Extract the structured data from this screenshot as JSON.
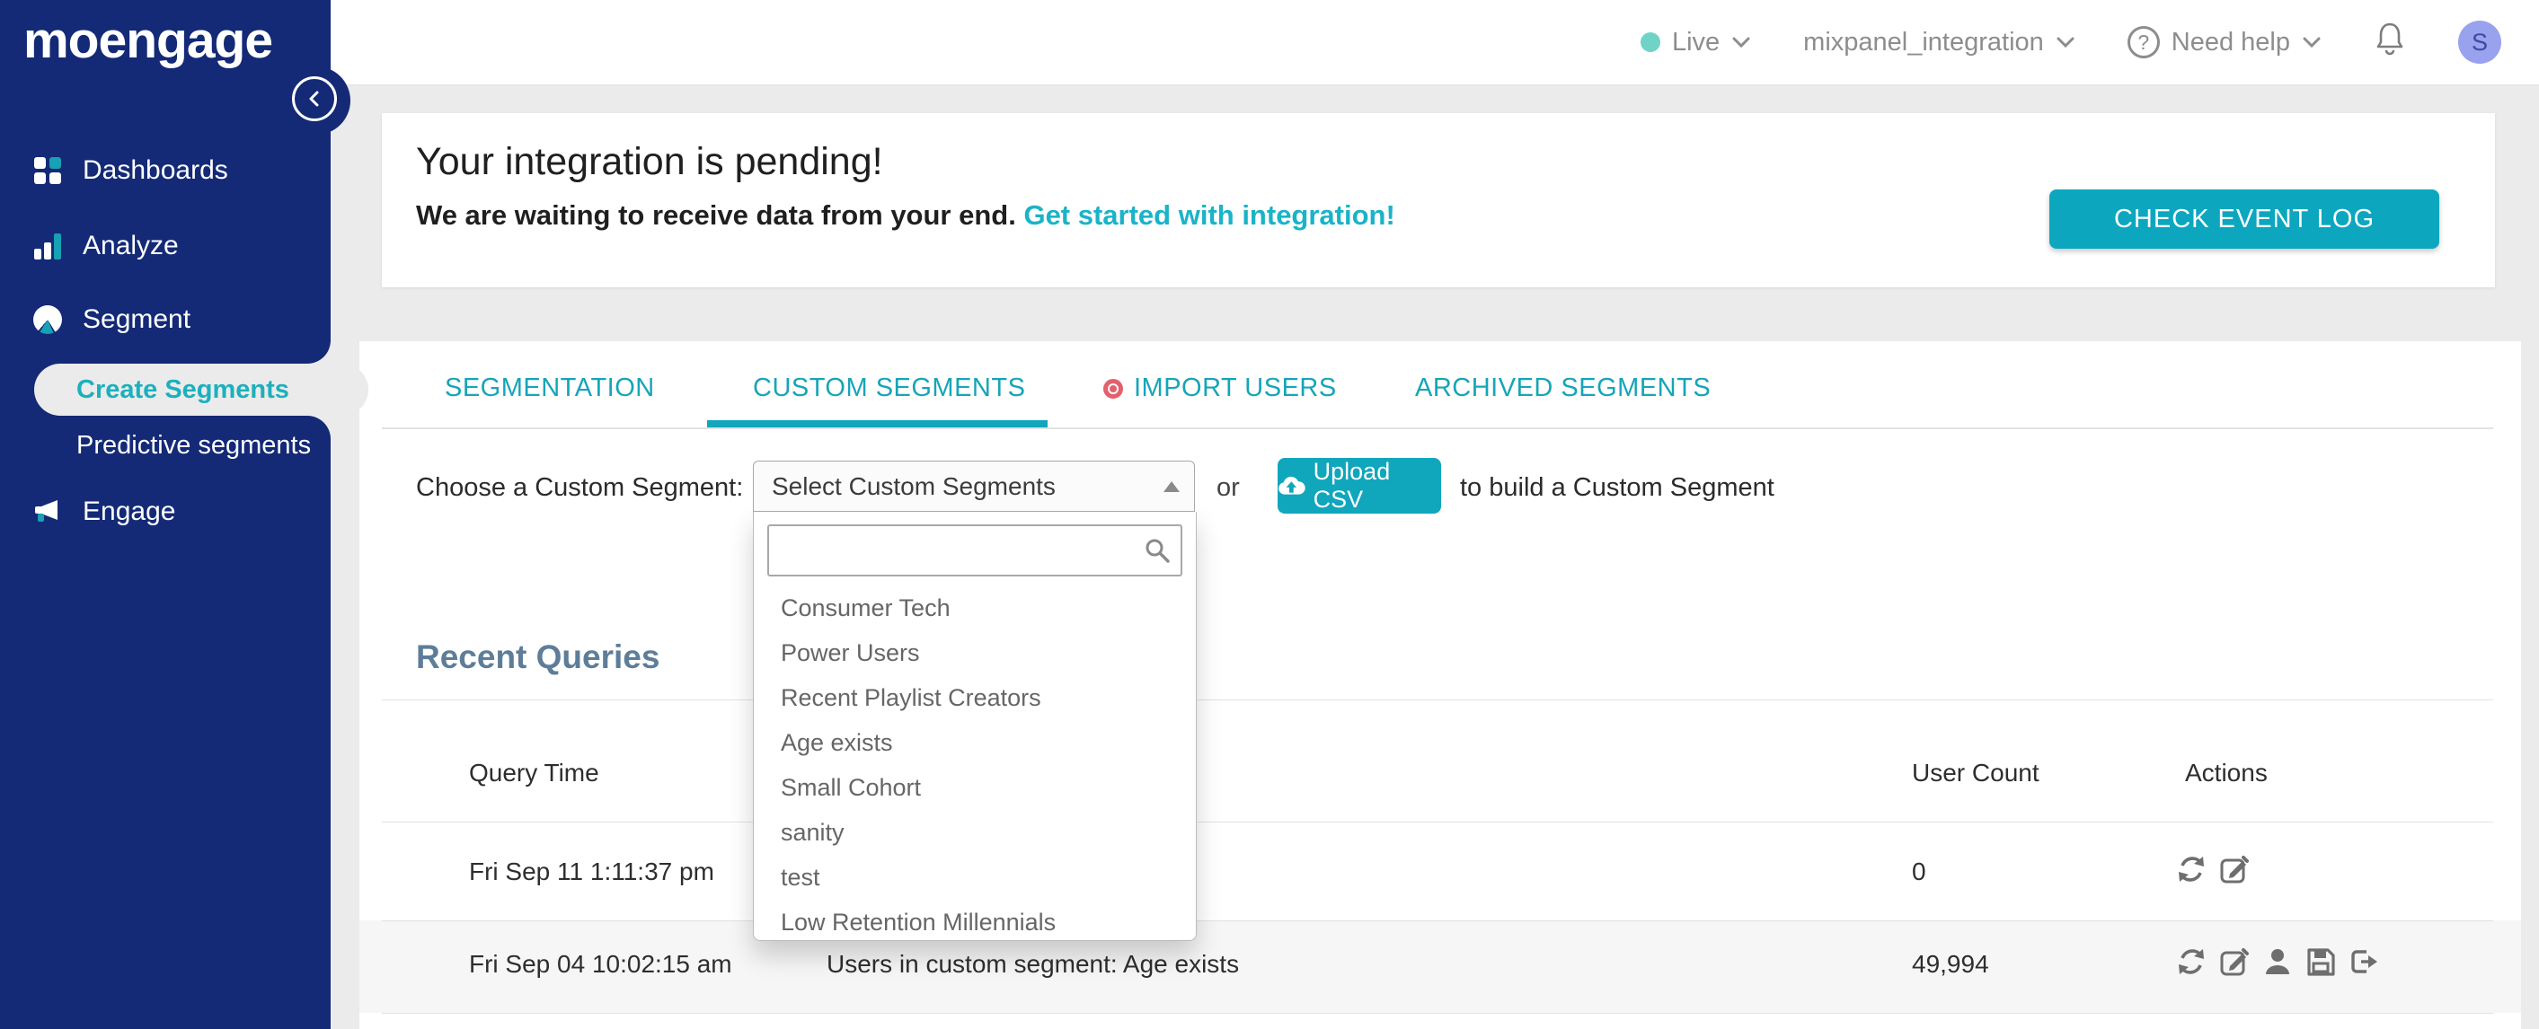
{
  "colors": {
    "navy": "#142a76",
    "teal": "#10a6bc",
    "link_teal": "#1ab3c8",
    "page_bg": "#ebebeb",
    "heading_slate": "#5d7d99",
    "red_badge": "#e4606d",
    "avatar_bg": "#98a2ee",
    "live_dot": "#6fd3c7"
  },
  "topbar": {
    "env_label": "Live",
    "workspace": "mixpanel_integration",
    "help_label": "Need help",
    "avatar_initial": "S"
  },
  "sidebar": {
    "logo": "moengage",
    "menu": [
      {
        "label": "Dashboards",
        "icon": "grid-icon"
      },
      {
        "label": "Analyze",
        "icon": "bar-chart-icon"
      },
      {
        "label": "Segment",
        "icon": "pie-chart-icon"
      }
    ],
    "submenu": [
      {
        "label": "Create Segments",
        "active": true
      },
      {
        "label": "Predictive segments",
        "active": false
      }
    ],
    "menu_bottom": [
      {
        "label": "Engage",
        "icon": "megaphone-icon"
      }
    ]
  },
  "banner": {
    "title": "Your integration is pending!",
    "message": "We are waiting to receive data from your end. ",
    "link": "Get started with integration!",
    "button": "CHECK EVENT LOG"
  },
  "tabs": [
    {
      "label": "SEGMENTATION",
      "active": false
    },
    {
      "label": "CUSTOM SEGMENTS",
      "active": true
    },
    {
      "label": "IMPORT USERS",
      "active": false,
      "badge": "red-dot"
    },
    {
      "label": "ARCHIVED SEGMENTS",
      "active": false
    }
  ],
  "picker": {
    "label": "Choose a Custom Segment:",
    "selected": "Select Custom Segments",
    "or": "or",
    "upload_button": "Upload CSV",
    "suffix": "to build a Custom Segment",
    "search_value": "",
    "options": [
      "Consumer Tech",
      "Power Users",
      "Recent Playlist Creators",
      "Age exists",
      "Small Cohort",
      "sanity",
      "test",
      "Low Retention Millennials"
    ]
  },
  "recent": {
    "heading": "Recent Queries",
    "columns": {
      "time": "Query Time",
      "count": "User Count",
      "actions": "Actions"
    },
    "rows": [
      {
        "time": "Fri Sep 11 1:11:37 pm",
        "query": "",
        "count": "0"
      },
      {
        "time": "Fri Sep 04 10:02:15 am",
        "query": "Users in custom segment: Age exists",
        "count": "49,994"
      }
    ]
  }
}
